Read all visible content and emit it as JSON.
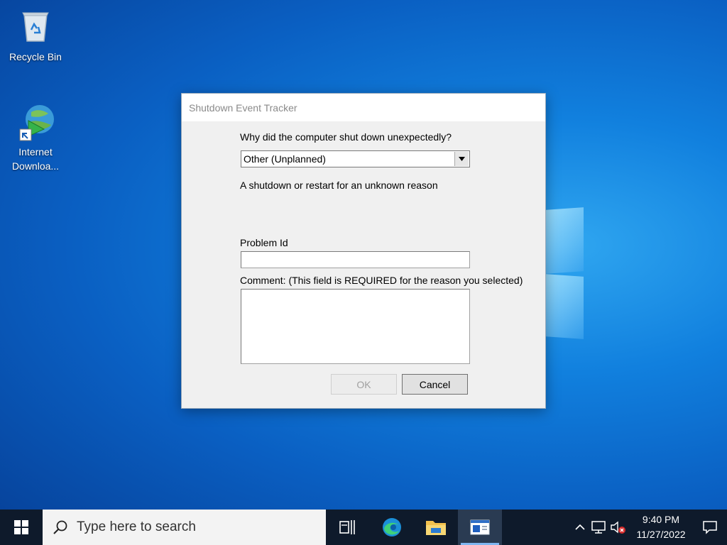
{
  "desktop": {
    "icons": [
      {
        "label": "Recycle Bin"
      },
      {
        "label": "Internet Downloa..."
      }
    ]
  },
  "dialog": {
    "title": "Shutdown Event Tracker",
    "question": "Why did the computer shut down unexpectedly?",
    "reason_selected": "Other (Unplanned)",
    "reason_description": "A shutdown or restart for an unknown reason",
    "problem_id_label": "Problem Id",
    "problem_id_value": "",
    "comment_label": "Comment: (This field is REQUIRED for the reason you selected)",
    "comment_value": "",
    "ok_label": "OK",
    "cancel_label": "Cancel"
  },
  "taskbar": {
    "search_placeholder": "Type here to search",
    "time": "9:40 PM",
    "date": "11/27/2022",
    "apps": [
      "task-view",
      "edge",
      "file-explorer",
      "shutdown-tracker"
    ]
  },
  "colors": {
    "taskbar_bg": "#0e1a2b",
    "desktop_accent": "#1180de"
  }
}
